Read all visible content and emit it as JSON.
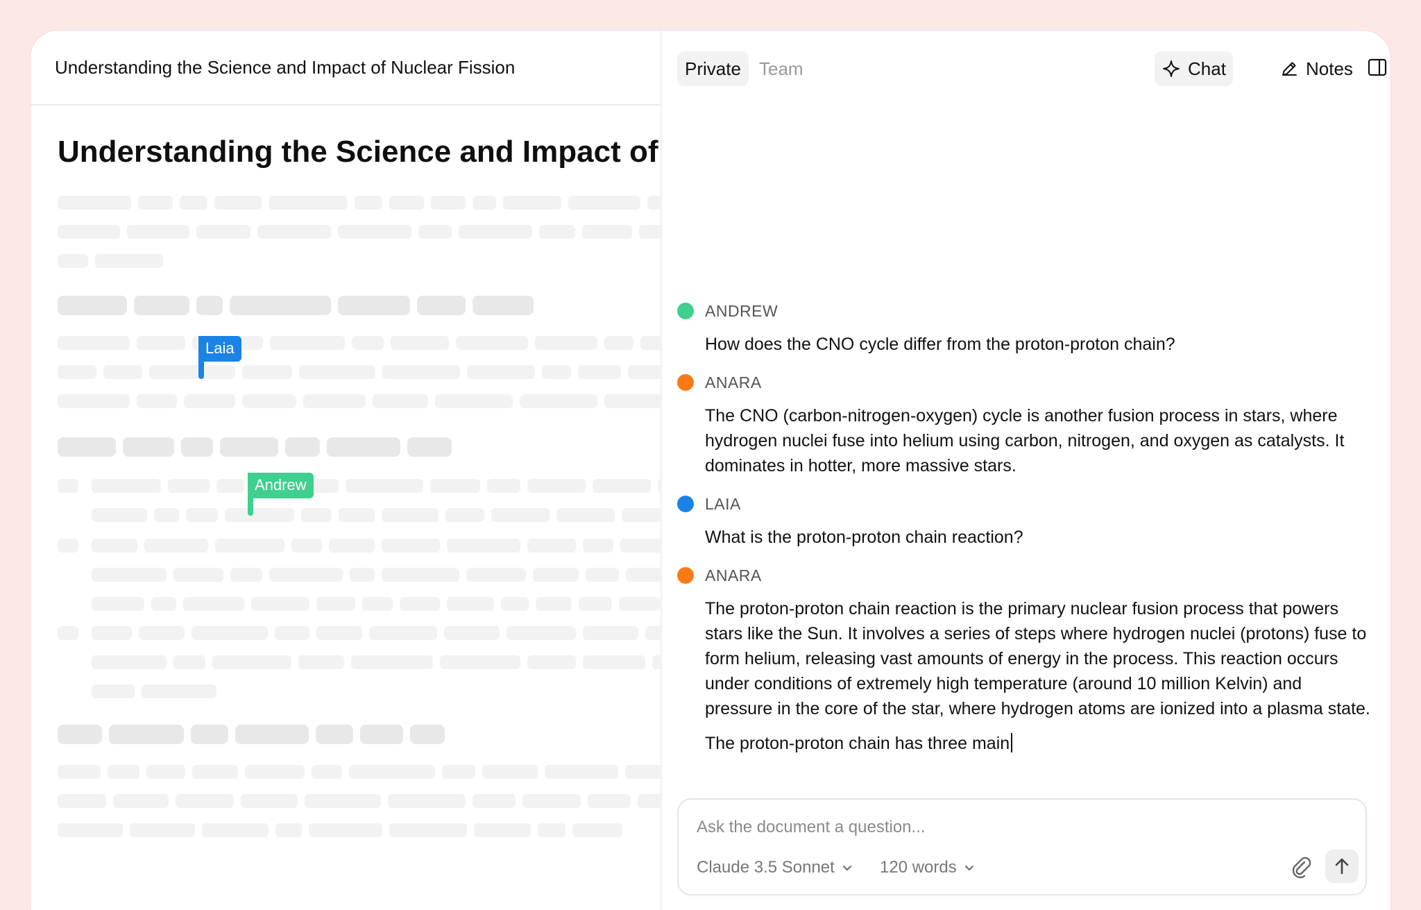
{
  "document": {
    "header_title": "Understanding the Science and Impact of Nuclear Fission",
    "title": "Understanding the Science and Impact of"
  },
  "cursors": [
    {
      "name": "Laia",
      "color": "#1a84e6"
    },
    {
      "name": "Andrew",
      "color": "#3fcf8e"
    }
  ],
  "tabs": {
    "private_label": "Private",
    "team_label": "Team"
  },
  "toolbar": {
    "chat_label": "Chat",
    "notes_label": "Notes"
  },
  "messages": [
    {
      "author": "ANDREW",
      "color": "#3fcf8e",
      "paragraphs": [
        "How does the CNO cycle differ from the proton-proton chain?"
      ]
    },
    {
      "author": "ANARA",
      "color": "#fb7a14",
      "paragraphs": [
        "The CNO (carbon-nitrogen-oxygen) cycle is another fusion process in stars, where hydrogen nuclei fuse into helium using carbon, nitrogen, and oxygen as catalysts. It dominates in hotter, more massive stars."
      ]
    },
    {
      "author": "LAIA",
      "color": "#1a84e6",
      "paragraphs": [
        "What is the proton-proton chain reaction?"
      ]
    },
    {
      "author": "ANARA",
      "color": "#fb7a14",
      "paragraphs": [
        "The proton-proton chain reaction is the primary nuclear fusion process that powers stars like the Sun. It involves a series of steps where hydrogen nuclei (protons) fuse to form helium, releasing vast amounts of energy in the process. This reaction occurs under conditions of extremely high temperature (around 10 million Kelvin) and pressure in the core of the star, where hydrogen atoms are ionized into a plasma state.",
        "The proton-proton chain has three main"
      ]
    }
  ],
  "composer": {
    "placeholder": "Ask the document a question...",
    "model_label": "Claude 3.5 Sonnet",
    "length_label": "120 words"
  },
  "icons": {
    "chat": "sparkle-icon",
    "notes": "pencil-icon",
    "panel": "sidebar-panel-icon",
    "attach": "paperclip-icon",
    "send": "arrow-up-icon",
    "dropdown": "chevron-down-icon"
  }
}
